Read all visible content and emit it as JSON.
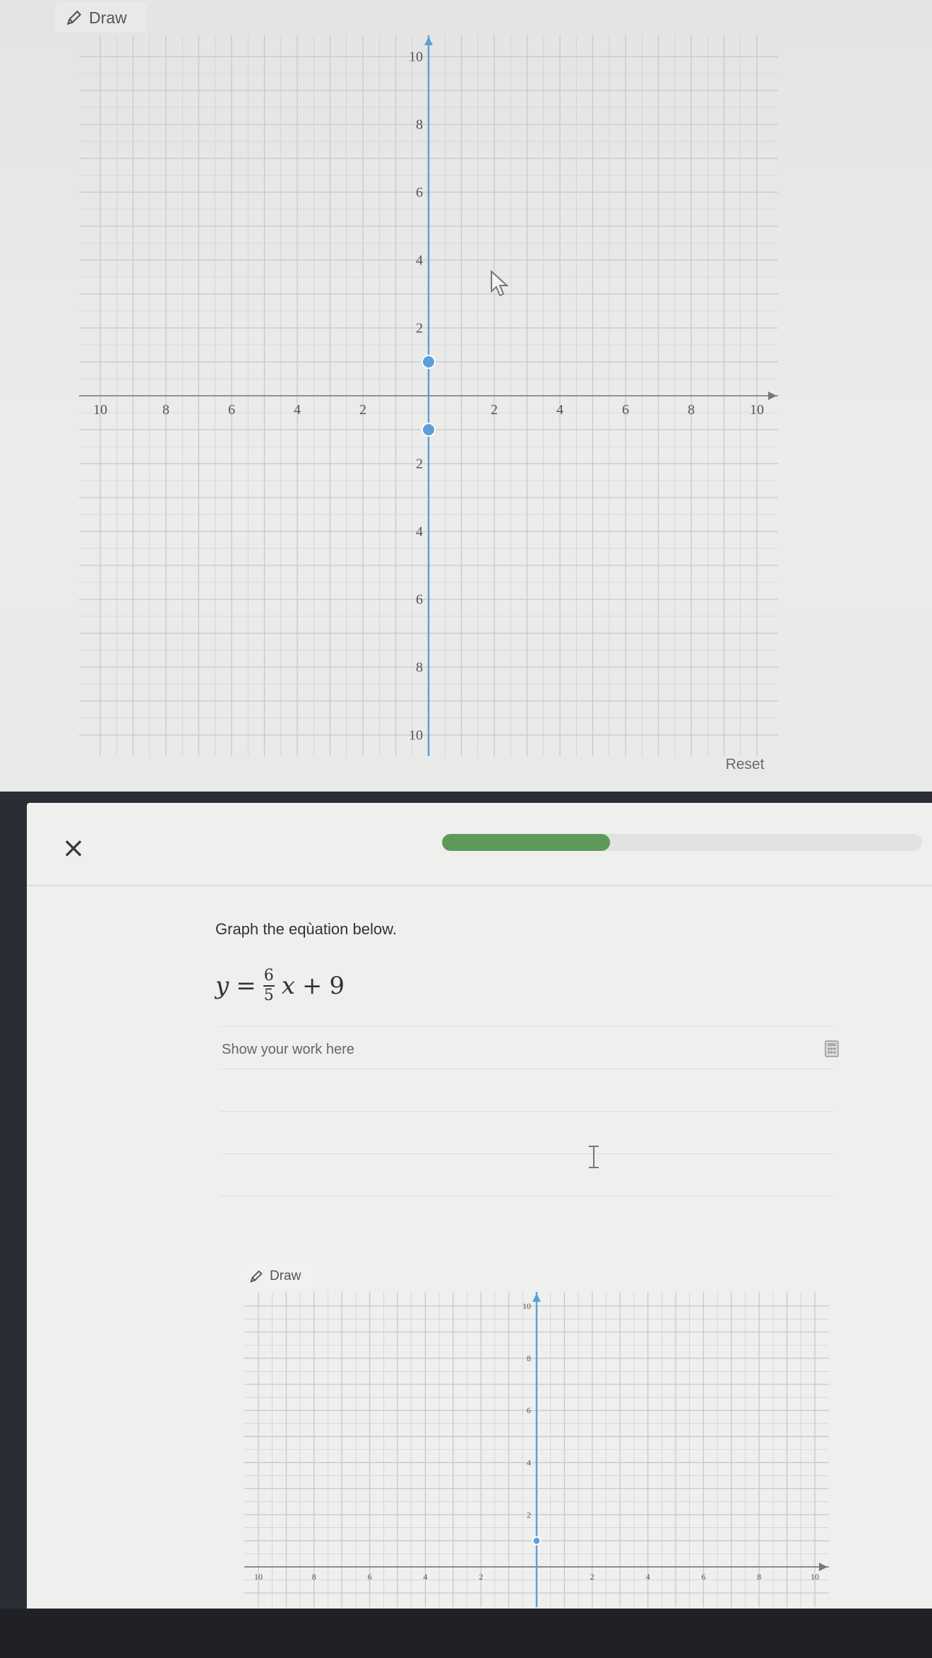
{
  "top": {
    "draw_label": "Draw",
    "reset_label": "Reset"
  },
  "app": {
    "close_glyph": "×",
    "progress_percent": 35,
    "question": "Graph the eqùation below.",
    "equation": {
      "lhs": "y",
      "eq": "=",
      "num": "6",
      "den": "5",
      "var": "x",
      "op": "+",
      "const": "9"
    },
    "work_placeholder": "Show your work here",
    "draw_label": "Draw"
  },
  "colors": {
    "line": "#5a9fd9",
    "point": "#5a9fd9",
    "progress": "#5d9a59",
    "grid": "#c8c8c8"
  },
  "icons": [
    "pencil-icon",
    "mouse-pointer-icon",
    "close-icon",
    "calculator-icon",
    "text-cursor-icon"
  ],
  "chart_data": [
    {
      "type": "scatter",
      "name": "top-graph",
      "xlim": [
        -10,
        10
      ],
      "ylim": [
        -10,
        10
      ],
      "x_ticks": [
        -10,
        -8,
        -6,
        -4,
        -2,
        2,
        4,
        6,
        8,
        10
      ],
      "y_ticks": [
        10,
        8,
        6,
        4,
        2,
        -2,
        -4,
        -6,
        -8,
        -10
      ],
      "grid": true,
      "points": [
        {
          "x": 0,
          "y": 1
        },
        {
          "x": 0,
          "y": -1
        }
      ],
      "line": {
        "type": "vertical",
        "x": 0
      }
    },
    {
      "type": "scatter",
      "name": "bottom-graph",
      "xlim": [
        -10,
        10
      ],
      "ylim": [
        -1,
        10
      ],
      "x_ticks": [
        -10,
        -8,
        -6,
        -4,
        -2,
        2,
        4,
        6,
        8,
        10
      ],
      "y_ticks": [
        10,
        8,
        6,
        4,
        2
      ],
      "grid": true,
      "points": [
        {
          "x": 0,
          "y": 1
        }
      ],
      "line": {
        "type": "vertical",
        "x": 0
      }
    }
  ]
}
